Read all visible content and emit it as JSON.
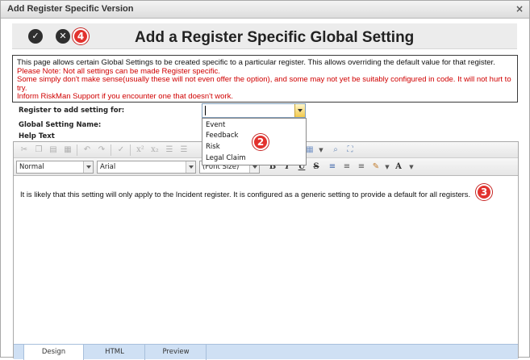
{
  "window": {
    "title": "Add Register Specific Version",
    "close_glyph": "×"
  },
  "header": {
    "title": "Add a Register Specific Global Setting",
    "ok_icon": "check-circle-icon",
    "cancel_icon": "x-circle-icon",
    "callout": "4"
  },
  "info": {
    "line1": "This page allows certain Global Settings to be created specific to a particular register. This allows overriding the default value for that register.",
    "line2": "Please Note: Not all settings can be made Register specific.",
    "line3": "Some simply don't make sense(usually these will not even offer the option), and some may not yet be suitably configured in code. It will not hurt to try.",
    "line4": "Inform RiskMan Support if you encounter one that doesn't work."
  },
  "form": {
    "register_label": "Register to add setting for:",
    "register_value": "",
    "global_setting_label": "Global Setting Name:",
    "help_text_label": "Help Text"
  },
  "dropdown": {
    "options": [
      "Event",
      "Feedback",
      "Risk",
      "Legal Claim"
    ],
    "callout": "2"
  },
  "toolbar": {
    "style": "Normal",
    "font": "Arial",
    "size": "(Font Size)",
    "bold": "B",
    "italic": "I",
    "underline": "U",
    "strike": "S",
    "fontcolor": "A",
    "superscript": "x²",
    "subscript": "x₂"
  },
  "editor": {
    "content": "It is likely that this setting will only apply to the Incident register. It is configured as a generic setting to provide a default for all registers.",
    "callout": "3"
  },
  "tabs": [
    "Design",
    "HTML",
    "Preview"
  ],
  "colors": {
    "callout": "#e2322e",
    "warning_text": "#d00000",
    "tab_bar": "#cfe0f4"
  }
}
